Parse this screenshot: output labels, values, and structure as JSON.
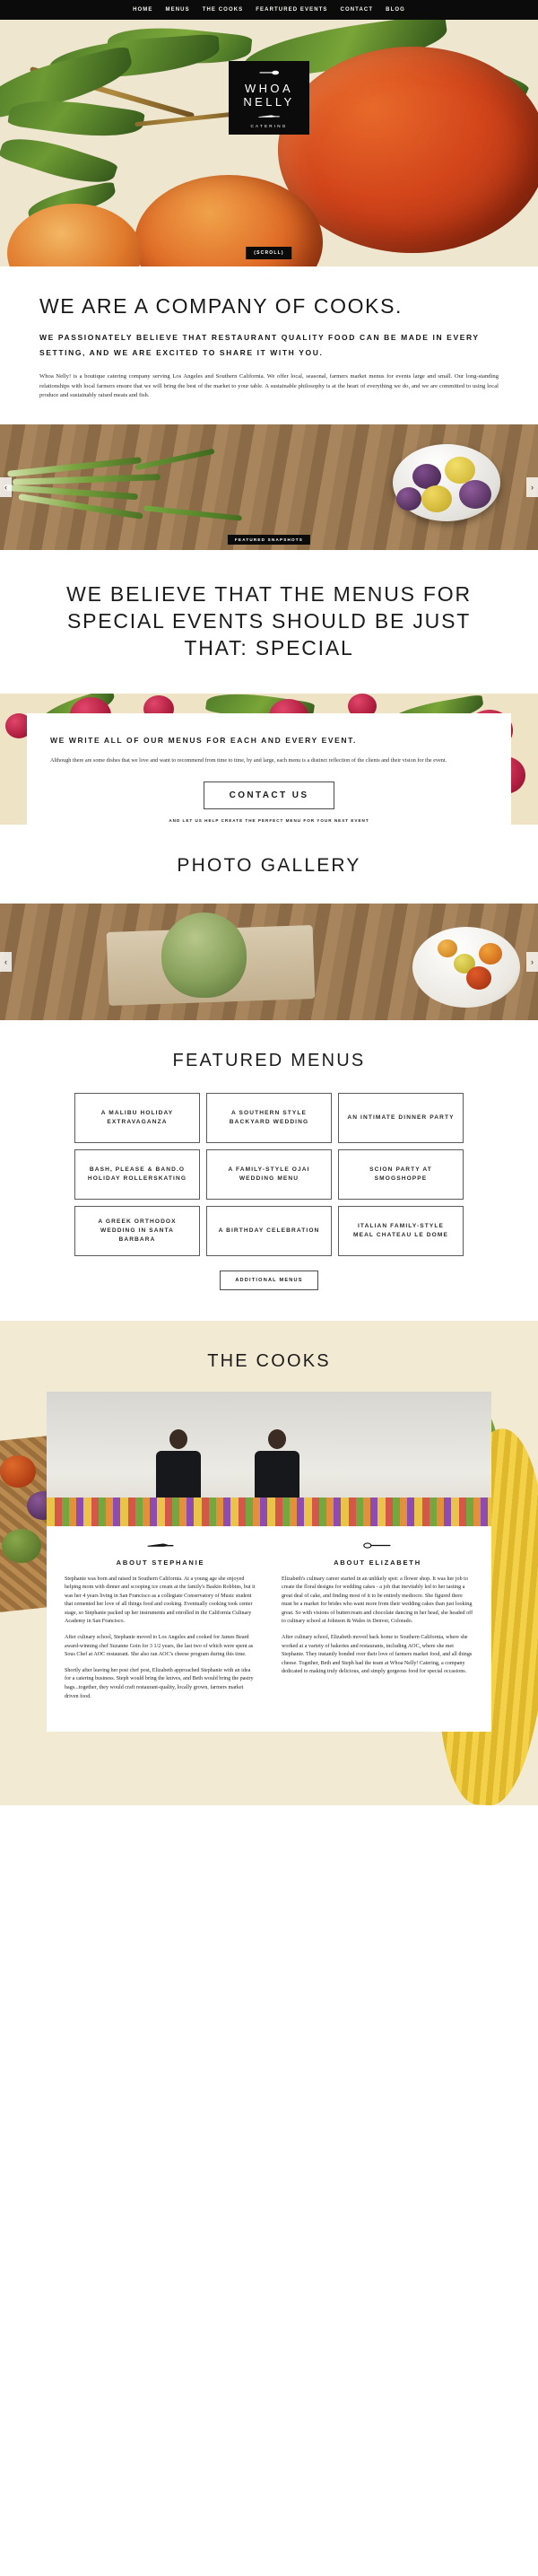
{
  "nav": {
    "items": [
      {
        "label": "HOME",
        "name": "nav-home"
      },
      {
        "label": "MENUS",
        "name": "nav-menus"
      },
      {
        "label": "THE COOKS",
        "name": "nav-the-cooks"
      },
      {
        "label": "FEARTURED EVENTS",
        "name": "nav-featured-events"
      },
      {
        "label": "CONTACT",
        "name": "nav-contact"
      },
      {
        "label": "BLOG",
        "name": "nav-blog"
      }
    ]
  },
  "hero": {
    "logo_line1": "WHOA",
    "logo_line2": "NELLY",
    "logo_sub": "CATERING",
    "scroll_label": "(SCROLL)"
  },
  "intro": {
    "heading": "WE ARE A COMPANY OF COOKS.",
    "subheading": "WE PASSIONATELY BELIEVE THAT RESTAURANT QUALITY FOOD CAN BE MADE IN EVERY SETTING, AND WE ARE EXCITED TO SHARE IT WITH YOU.",
    "paragraph": "Whoa Nelly! is a boutique catering company serving Los Angeles and Southern California. We offer local, seasonal, farmers market menus for events large and small. Our long-standing relationships with local farmers ensure that we will bring the best of the market to your table. A sustainable philosophy is at the heart of everything we do, and we are committed to using local produce and sustainably raised meats and fish."
  },
  "snapshots": {
    "badge": "FEATURED SNAPSHOTS",
    "prev": "‹",
    "next": "›"
  },
  "believe": {
    "heading": "WE BELIEVE THAT THE MENUS FOR SPECIAL EVENTS SHOULD BE JUST THAT: SPECIAL"
  },
  "menucard": {
    "heading": "WE WRITE ALL OF OUR MENUS FOR EACH AND EVERY EVENT.",
    "body": "Although there are some dishes that we love and want to recommend from time to time, by and large, each menu is a distinct reflection of the clients and their vision for the event.",
    "cta_label": "CONTACT US",
    "cta_note": "AND LET US HELP CREATE THE PERFECT MENU FOR YOUR NEXT EVENT"
  },
  "gallery": {
    "heading": "PHOTO GALLERY",
    "prev": "‹",
    "next": "›"
  },
  "featured_menus": {
    "heading": "FEATURED MENUS",
    "items": [
      "A MALIBU HOLIDAY EXTRAVAGANZA",
      "A SOUTHERN STYLE BACKYARD WEDDING",
      "AN INTIMATE DINNER PARTY",
      "BASH, PLEASE & BAND.O HOLIDAY ROLLERSKATING",
      "A FAMILY-STYLE OJAI WEDDING MENU",
      "SCION PARTY AT SMOGSHOPPE",
      "A GREEK ORTHODOX WEDDING IN SANTA BARBARA",
      "A BIRTHDAY CELEBRATION",
      "ITALIAN FAMILY-STYLE MEAL CHATEAU LE DOME"
    ],
    "more_label": "ADDITIONAL MENUS"
  },
  "cooks": {
    "heading": "THE COOKS",
    "stephanie": {
      "title": "ABOUT STEPHANIE",
      "paragraphs": [
        "Stephanie was born and raised in Southern California. At a young age she enjoyed helping mom with dinner and scooping ice cream at the family's Baskin Robbins, but it was her 4 years living in San Francisco as a collegiate Conservatory of Music student that cemented her love of all things food and cooking. Eventually cooking took center stage, so Stephanie packed up her instruments and enrolled in the California Culinary Academy in San Francisco.",
        "After culinary school, Stephanie moved to Los Angeles and cooked for James Beard award-winning chef Suzanne Goin for 3 1/2 years, the last two of which were spent as Sous Chef at AOC restaurant. She also ran AOC's cheese program during this time.",
        "Shortly after leaving her post chef post, Elizabeth approached Stephanie with an idea for a catering business. Steph would bring the knives, and Beth would bring the pastry bags...together, they would craft restaurant-quality, locally grown, farmers market driven food."
      ]
    },
    "elizabeth": {
      "title": "ABOUT ELIZABETH",
      "paragraphs": [
        "Elizabeth's culinary career started in an unlikely spot: a flower shop. It was her job to create the floral designs for wedding cakes - a job that inevitably led to her tasting a great deal of cake, and finding most of it to be entirely mediocre. She figured there must be a market for brides who want more from their wedding cakes than just looking great. So with visions of buttercream and chocolate dancing in her head, she headed off to culinary school at Johnson & Wales in Denver, Colorado.",
        "After culinary school, Elizabeth moved back home to Southern California, where she worked at a variety of bakeries and restaurants, including AOC, where she met Stephanie. They instantly bonded over their love of farmers market food, and all things cheese. Together, Beth and Steph had the team at Whoa Nelly! Catering, a company dedicated to making truly delicious, and simply gorgeous food for special occasions."
      ]
    }
  }
}
